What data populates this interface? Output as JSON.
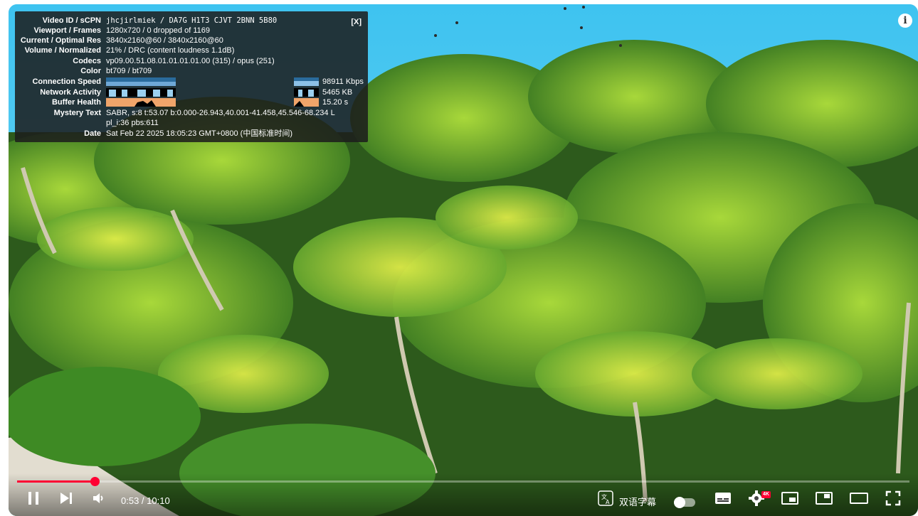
{
  "stats": {
    "close_label": "[X]",
    "rows": [
      {
        "label": "Video ID / sCPN",
        "value": "jhcjirlmiek / DA7G H1T3 CJVT 2BNN 5B80"
      },
      {
        "label": "Viewport / Frames",
        "value": "1280x720 / 0 dropped of 1169"
      },
      {
        "label": "Current / Optimal Res",
        "value": "3840x2160@60 / 3840x2160@60"
      },
      {
        "label": "Volume / Normalized",
        "value": "21% / DRC (content loudness 1.1dB)"
      },
      {
        "label": "Codecs",
        "value": "vp09.00.51.08.01.01.01.01.00 (315) / opus (251)"
      },
      {
        "label": "Color",
        "value": "bt709 / bt709"
      },
      {
        "label": "Connection Speed",
        "value": "98911 Kbps"
      },
      {
        "label": "Network Activity",
        "value": "5465 KB"
      },
      {
        "label": "Buffer Health",
        "value": "15.20 s"
      },
      {
        "label": "Mystery Text",
        "value": "SABR, s:8 t:53.07 b:0.000-26.943,40.001-41.458,45.546-68.234 L",
        "value2": "pl_i:36 pbs:611"
      },
      {
        "label": "Date",
        "value": "Sat Feb 22 2025 18:05:23 GMT+0800 (中国标准时间)"
      }
    ]
  },
  "player": {
    "info_icon": "info-icon",
    "time": "0:53 / 10:10",
    "progress_fraction": 0.087,
    "subtitle_label": "双语字幕",
    "quality_badge": "4K",
    "accent": "#ff0033",
    "icons": [
      "pause-icon",
      "next-icon",
      "volume-icon",
      "translate-icon",
      "subtitles-icon",
      "settings-icon",
      "miniplayer-icon",
      "pip-icon",
      "theater-icon",
      "fullscreen-icon"
    ]
  }
}
